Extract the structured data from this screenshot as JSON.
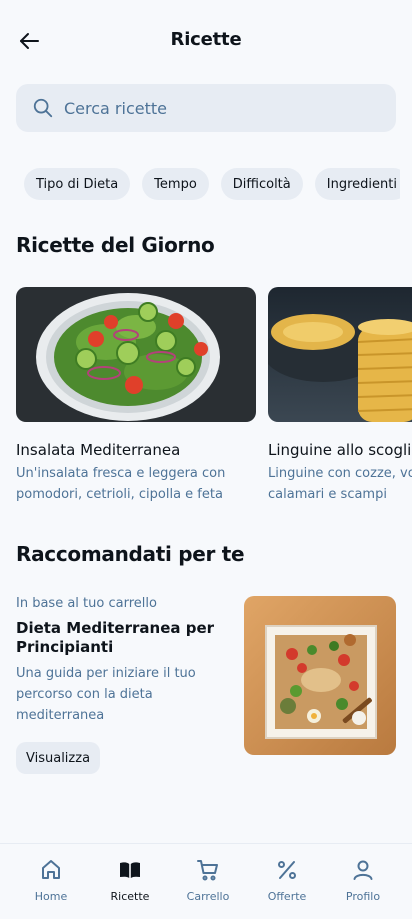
{
  "header": {
    "title": "Ricette",
    "back_icon": "arrow-left-icon"
  },
  "search": {
    "placeholder": "Cerca ricette",
    "icon": "search-icon"
  },
  "filters": [
    "Tipo di Dieta",
    "Tempo",
    "Difficoltà",
    "Ingredienti"
  ],
  "daily": {
    "title": "Ricette del Giorno",
    "cards": [
      {
        "title": "Insalata Mediterranea",
        "desc": "Un'insalata fresca e leggera con pomodori, cetrioli, cipolla e feta"
      },
      {
        "title": "Linguine allo scoglio",
        "desc": "Linguine con cozze, vongole, calamari e scampi"
      }
    ]
  },
  "recommended": {
    "title": "Raccomandati per te",
    "kicker": "In base al tuo carrello",
    "item_title": "Dieta Mediterranea per Principianti",
    "item_desc": "Una guida per iniziare il tuo percorso con la dieta mediterranea",
    "button": "Visualizza"
  },
  "nav": [
    {
      "label": "Home",
      "icon": "home-icon",
      "active": false
    },
    {
      "label": "Ricette",
      "icon": "book-icon",
      "active": true
    },
    {
      "label": "Carrello",
      "icon": "cart-icon",
      "active": false
    },
    {
      "label": "Offerte",
      "icon": "percent-icon",
      "active": false
    },
    {
      "label": "Profilo",
      "icon": "user-icon",
      "active": false
    }
  ],
  "colors": {
    "background": "#f7f9fc",
    "surface": "#e7ecf3",
    "text": "#0e141b",
    "muted": "#4e7397"
  }
}
